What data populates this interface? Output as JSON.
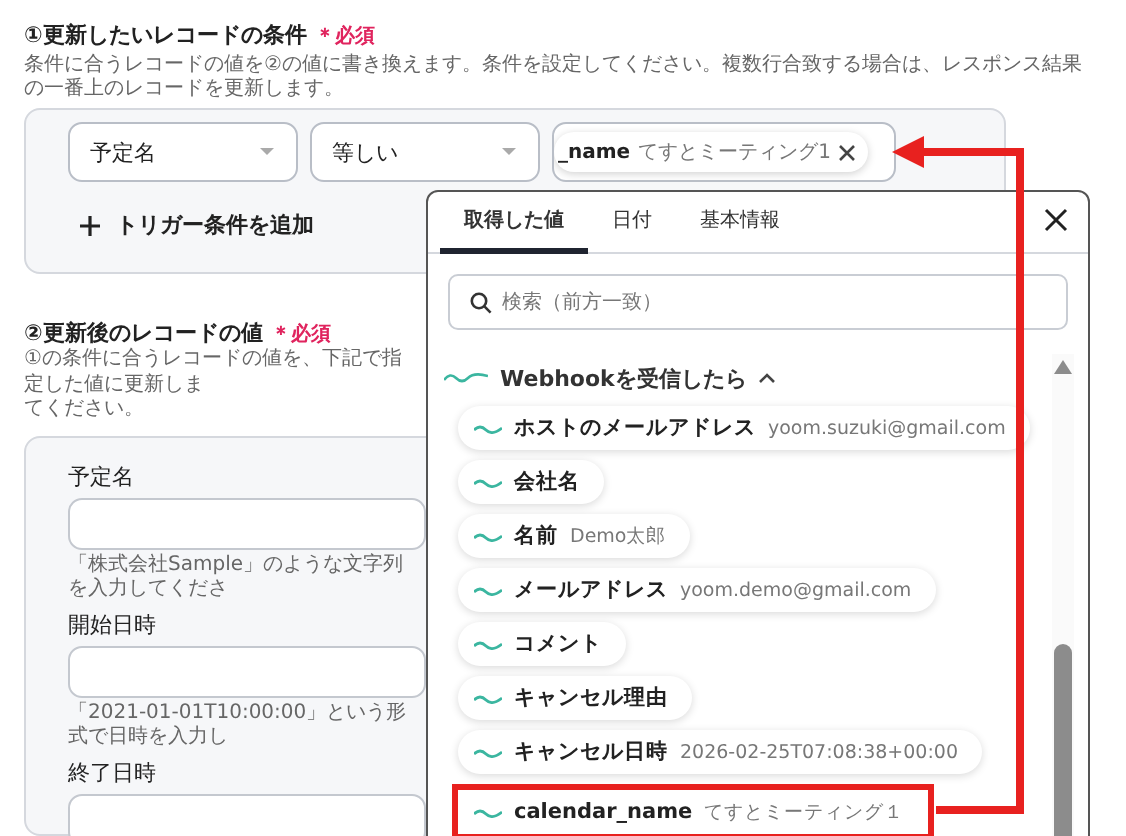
{
  "condition_section": {
    "title": "①更新したいレコードの条件",
    "required": "＊必須",
    "description": "条件に合うレコードの値を②の値に書き換えます。条件を設定してください。複数行合致する場合は、レスポンス結果の一番上のレコードを更新します。",
    "field": "予定名",
    "operator": "等しい",
    "value_chip": {
      "label": "_name",
      "value": "てすとミーティング1"
    },
    "add_button": "トリガー条件を追加"
  },
  "values_section": {
    "title": "②更新後のレコードの値",
    "required": "＊必須",
    "description_lines": [
      "①の条件に合うレコードの値を、下記で指定した値に更新しま",
      "てください。"
    ],
    "fields": [
      {
        "label": "予定名",
        "hint": "「株式会社Sample」のような文字列を入力してくださ"
      },
      {
        "label": "開始日時",
        "hint": "「2021-01-01T10:00:00」という形式で日時を入力し"
      },
      {
        "label": "終了日時"
      }
    ]
  },
  "picker": {
    "tabs": [
      {
        "label": "取得した値",
        "selected": true
      },
      {
        "label": "日付",
        "selected": false
      },
      {
        "label": "基本情報",
        "selected": false
      }
    ],
    "search": {
      "placeholder": "検索（前方一致）"
    },
    "group": {
      "title": "Webhookを受信したら",
      "expanded": true,
      "items": [
        {
          "label": "ホストのメールアドレス",
          "value": "yoom.suzuki@gmail.com",
          "highlighted": false
        },
        {
          "label": "会社名",
          "highlighted": false
        },
        {
          "label": "名前",
          "value": "Demo太郎",
          "highlighted": false
        },
        {
          "label": "メールアドレス",
          "value": "yoom.demo@gmail.com",
          "highlighted": false
        },
        {
          "label": "コメント",
          "highlighted": false
        },
        {
          "label": "キャンセル理由",
          "highlighted": false
        },
        {
          "label": "キャンセル日時",
          "value": "2026-02-25T07:08:38+00:00",
          "highlighted": false
        },
        {
          "label": "calendar_name",
          "value": "てすとミーティング１",
          "highlighted": true
        }
      ]
    }
  }
}
